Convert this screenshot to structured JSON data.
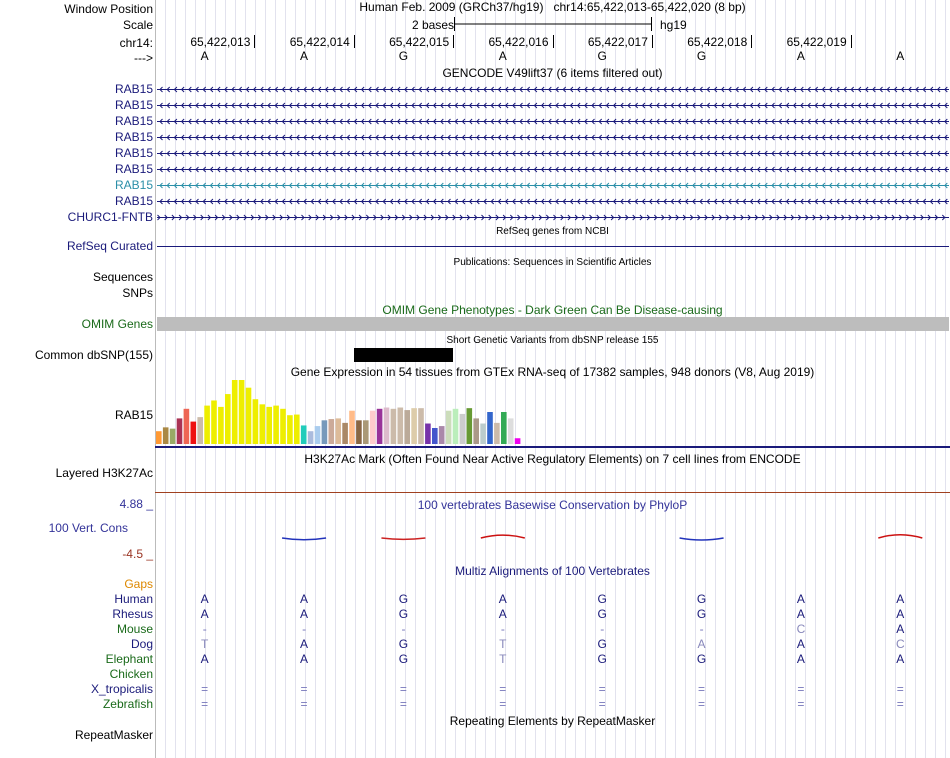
{
  "ruler": {
    "window_position_label": "Window Position",
    "scale_label": "Scale",
    "chrom_label": "chr14:",
    "strand_label": "--->",
    "window_title": "Human Feb. 2009 (GRCh37/hg19)   chr14:65,422,013-65,422,020 (8 bp)",
    "scale_text": "2 bases",
    "assembly": "hg19",
    "positions": [
      "65,422,013",
      "65,422,014",
      "65,422,015",
      "65,422,016",
      "65,422,017",
      "65,422,018",
      "65,422,019"
    ],
    "bases": [
      "A",
      "A",
      "G",
      "A",
      "G",
      "G",
      "A",
      "A"
    ]
  },
  "gencode": {
    "title": "GENCODE V49lift37 (6 items filtered out)",
    "items": [
      "RAB15",
      "RAB15",
      "RAB15",
      "RAB15",
      "RAB15",
      "RAB15",
      "RAB15",
      "RAB15",
      "CHURC1-FNTB"
    ],
    "strands": [
      "<",
      "<",
      "<",
      "<",
      "<",
      "<",
      "<",
      "<",
      ">"
    ],
    "colors": [
      "#1a1a7a",
      "#1a1a7a",
      "#1a1a7a",
      "#1a1a7a",
      "#1a1a7a",
      "#1a1a7a",
      "#2b8fa8",
      "#1a1a7a",
      "#1a1a7a"
    ]
  },
  "refseq": {
    "label": "RefSeq Curated",
    "title": "RefSeq genes from NCBI"
  },
  "publications": {
    "title": "Publications: Sequences in Scientific Articles",
    "label_sequences": "Sequences",
    "label_snps": "SNPs"
  },
  "omim": {
    "title": "OMIM Gene Phenotypes - Dark Green Can Be Disease-causing",
    "label": "OMIM Genes"
  },
  "dbsnp": {
    "title": "Short Genetic Variants from dbSNP release 155",
    "label": "Common dbSNP(155)"
  },
  "gtex": {
    "title": "Gene Expression in 54 tissues from GTEx RNA-seq of 17382 samples, 948 donors (V8, Aug 2019)",
    "label": "RAB15",
    "levels": [
      0.2,
      0.26,
      0.24,
      0.4,
      0.55,
      0.35,
      0.42,
      0.6,
      0.68,
      0.58,
      0.78,
      1.0,
      1.0,
      0.88,
      0.7,
      0.62,
      0.58,
      0.6,
      0.55,
      0.45,
      0.46,
      0.29,
      0.2,
      0.28,
      0.37,
      0.39,
      0.4,
      0.33,
      0.52,
      0.37,
      0.37,
      0.52,
      0.55,
      0.57,
      0.55,
      0.57,
      0.53,
      0.56,
      0.56,
      0.32,
      0.25,
      0.28,
      0.52,
      0.55,
      0.47,
      0.56,
      0.4,
      0.32,
      0.5,
      0.33,
      0.5,
      0.4,
      0.09
    ],
    "colors": [
      "#ff9933",
      "#aa8844",
      "#99aa66",
      "#aa3355",
      "#ee6655",
      "#ee1111",
      "#ccbbaa",
      "#eeee00",
      "#eeee00",
      "#eeee00",
      "#eeee00",
      "#eeee00",
      "#eeee00",
      "#eeee00",
      "#eeee00",
      "#eeee00",
      "#eeee00",
      "#eeee00",
      "#eeee00",
      "#eeee00",
      "#eeee00",
      "#22ccbb",
      "#aabbdd",
      "#aaccee",
      "#7799bb",
      "#ccaa99",
      "#ddbb99",
      "#aa8866",
      "#ffbb88",
      "#886644",
      "#aa9977",
      "#ffcccc",
      "#993399",
      "#ddbbcc",
      "#ccbbaa",
      "#ccbbaa",
      "#bbaa99",
      "#ddccaa",
      "#ccbbaa",
      "#7733aa",
      "#4455cc",
      "#aa88aa",
      "#ccddbb",
      "#bbeebb",
      "#cccccc",
      "#669933",
      "#aa9988",
      "#bbcccc",
      "#3366cc",
      "#ccbbaa",
      "#33aa55",
      "#dddddd",
      "#ee00ee"
    ]
  },
  "h3k27ac": {
    "title": "H3K27Ac Mark (Often Found Near Active Regulatory Elements) on 7 cell lines from ENCODE",
    "label": "Layered H3K27Ac"
  },
  "phylop": {
    "title": "100 vertebrates Basewise Conservation by PhyloP",
    "label": "100 Vert. Cons",
    "max_label": "4.88 _",
    "min_label": "-4.5 _",
    "scores": [
      0,
      -0.8,
      -0.6,
      1.3,
      0,
      -0.9,
      0,
      1.5
    ]
  },
  "multiz": {
    "title": "Multiz Alignments of 100 Vertebrates",
    "gaps_label": "Gaps",
    "species": [
      {
        "name": "Human",
        "color": "#1a1a7a",
        "bases": [
          "A",
          "A",
          "G",
          "A",
          "G",
          "G",
          "A",
          "A"
        ]
      },
      {
        "name": "Rhesus",
        "color": "#1a1a7a",
        "bases": [
          "A",
          "A",
          "G",
          "A",
          "G",
          "G",
          "A",
          "A"
        ]
      },
      {
        "name": "Mouse",
        "color": "#1a6a1a",
        "bases": [
          "-",
          "-",
          "-",
          "-",
          "-",
          "-",
          "C",
          "A"
        ]
      },
      {
        "name": "Dog",
        "color": "#1a1a7a",
        "bases": [
          "T",
          "A",
          "G",
          "T",
          "G",
          "A",
          "A",
          "C"
        ]
      },
      {
        "name": "Elephant",
        "color": "#1a6a1a",
        "bases": [
          "A",
          "A",
          "G",
          "T",
          "G",
          "G",
          "A",
          "A"
        ]
      },
      {
        "name": "Chicken",
        "color": "#1a6a1a",
        "bases": [
          "",
          "",
          "",
          "",
          "",
          "",
          "",
          ""
        ]
      },
      {
        "name": "X_tropicalis",
        "color": "#1a1a7a",
        "bases": [
          "=",
          "=",
          "=",
          "=",
          "=",
          "=",
          "=",
          "="
        ]
      },
      {
        "name": "Zebrafish",
        "color": "#1a6a1a",
        "bases": [
          "=",
          "=",
          "=",
          "=",
          "=",
          "=",
          "=",
          "="
        ]
      }
    ]
  },
  "repeatmasker": {
    "title": "Repeating Elements by RepeatMasker",
    "label": "RepeatMasker"
  }
}
